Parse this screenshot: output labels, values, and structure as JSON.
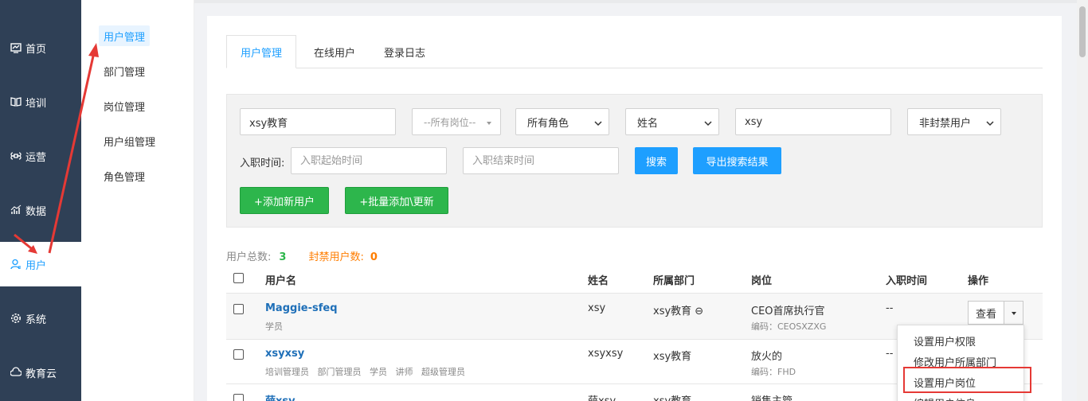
{
  "nav": {
    "items": [
      {
        "label": "首页",
        "icon": "dashboard-icon"
      },
      {
        "label": "培训",
        "icon": "book-icon"
      },
      {
        "label": "运营",
        "icon": "command-icon"
      },
      {
        "label": "数据",
        "icon": "chart-icon"
      },
      {
        "label": "用户",
        "icon": "user-icon"
      },
      {
        "label": "系统",
        "icon": "gear-icon"
      },
      {
        "label": "教育云",
        "icon": "cloud-icon"
      }
    ],
    "active": "用户"
  },
  "subnav": {
    "items": [
      "用户管理",
      "部门管理",
      "岗位管理",
      "用户组管理",
      "角色管理"
    ],
    "active": "用户管理"
  },
  "tabs": [
    "用户管理",
    "在线用户",
    "登录日志"
  ],
  "filters": {
    "org_value": "xsy教育",
    "position_select": "--所有岗位--",
    "role_select": "所有角色",
    "field_select": "姓名",
    "keyword_value": "xsy",
    "status_select": "非封禁用户",
    "join_time_label": "入职时间:",
    "start_placeholder": "入职起始时间",
    "end_placeholder": "入职结束时间",
    "search_button": "搜索",
    "export_button": "导出搜索结果",
    "add_button": "+添加新用户",
    "batch_button": "+批量添加\\更新"
  },
  "stats": {
    "total_label": "用户总数:",
    "total_value": "3",
    "banned_label": "封禁用户数:",
    "banned_value": "0"
  },
  "table": {
    "headers": [
      "用户名",
      "姓名",
      "所属部门",
      "岗位",
      "入职时间",
      "操作"
    ],
    "rows": [
      {
        "username": "Maggie-sfeq",
        "roles": "学员",
        "name": "xsy",
        "dept": "xsy教育 ⊖",
        "post": "CEO首席执行官",
        "code": "编码：CEOSXZXG",
        "join": "--"
      },
      {
        "username": "xsyxsy",
        "roles": "培训管理员   部门管理员   学员   讲师   超级管理员",
        "name": "xsyxsy",
        "dept": "xsy教育",
        "post": "放火的",
        "code": "编码：FHD",
        "join": "--"
      },
      {
        "username": "薛xsy",
        "roles": "",
        "name": "薛xsy",
        "dept": "xsy教育",
        "post": "销售主管",
        "code": "",
        "join": ""
      }
    ],
    "view_button": "查看"
  },
  "op_menu": [
    "设置用户权限",
    "修改用户所属部门",
    "设置用户岗位",
    "编辑用户信息"
  ],
  "colors": {
    "nav_bg": "#2f4056",
    "accent": "#1e9fff",
    "green": "#2db64c",
    "orange": "#ff7d00",
    "annotation": "#e53935"
  }
}
